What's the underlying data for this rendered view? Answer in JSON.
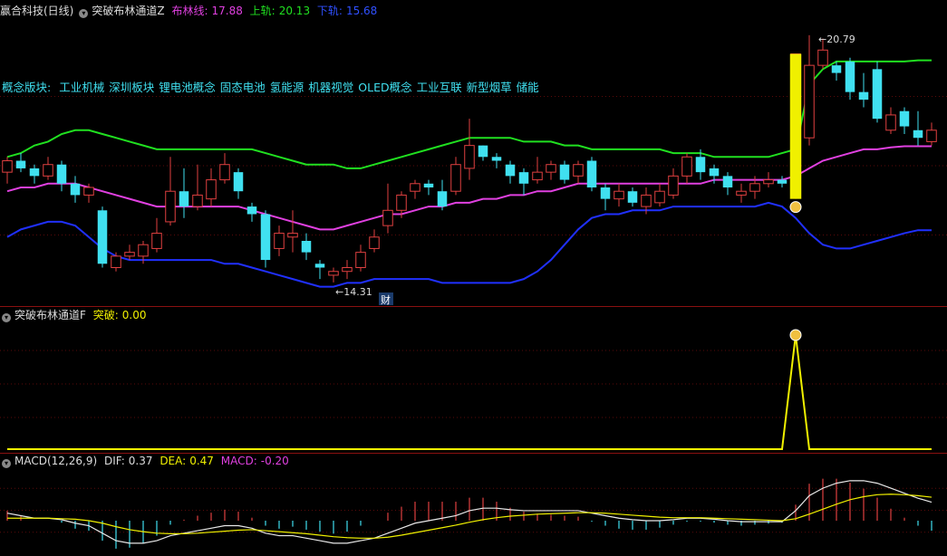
{
  "main_panel": {
    "stock_name": "赢合科技(日线)",
    "indicator": "突破布林通道Z",
    "mid_label": "布林线:",
    "mid_value": "17.88",
    "upper_label": "上轨:",
    "upper_value": "20.13",
    "lower_label": "下轨:",
    "lower_value": "15.68",
    "high_marker": "20.79",
    "low_marker": "14.31",
    "fin_marker": "财",
    "concept_label": "概念版块:",
    "concepts": [
      "工业机械",
      "深圳板块",
      "锂电池概念",
      "固态电池",
      "氢能源",
      "机器视觉",
      "OLED概念",
      "工业互联",
      "新型烟草",
      "储能"
    ]
  },
  "signal_panel": {
    "indicator": "突破布林通道F",
    "signal_label": "突破:",
    "signal_value": "0.00"
  },
  "macd_panel": {
    "indicator": "MACD(12,26,9)",
    "dif_label": "DIF:",
    "dif_value": "0.37",
    "dea_label": "DEA:",
    "dea_value": "0.47",
    "macd_label": "MACD:",
    "macd_value": "-0.20"
  },
  "colors": {
    "up": "#e04040",
    "down": "#40e0f0",
    "boll_mid": "#e040e0",
    "boll_up": "#20e020",
    "boll_dn": "#2030ff",
    "signal": "#f0f000",
    "dif": "#e8e8e8",
    "dea": "#f0f000"
  },
  "chart_data": {
    "type": "candlestick",
    "candles": [
      [
        17.2,
        17.5,
        16.9,
        17.6
      ],
      [
        17.5,
        17.3,
        17.2,
        17.7
      ],
      [
        17.3,
        17.1,
        16.9,
        17.4
      ],
      [
        17.1,
        17.4,
        17.0,
        17.6
      ],
      [
        17.4,
        16.9,
        16.7,
        17.5
      ],
      [
        16.9,
        16.6,
        16.4,
        17.1
      ],
      [
        16.6,
        16.8,
        16.4,
        16.9
      ],
      [
        16.2,
        14.8,
        14.7,
        16.3
      ],
      [
        14.7,
        15.0,
        14.6,
        15.1
      ],
      [
        15.0,
        15.1,
        14.9,
        15.3
      ],
      [
        15.0,
        15.3,
        14.8,
        15.4
      ],
      [
        15.2,
        15.6,
        15.1,
        16.0
      ],
      [
        15.9,
        16.7,
        15.8,
        17.6
      ],
      [
        16.7,
        16.3,
        16.0,
        17.3
      ],
      [
        16.3,
        16.6,
        16.2,
        17.4
      ],
      [
        16.5,
        17.0,
        16.3,
        17.3
      ],
      [
        17.0,
        17.4,
        16.9,
        17.7
      ],
      [
        17.2,
        16.7,
        16.5,
        17.3
      ],
      [
        16.3,
        16.1,
        15.9,
        16.4
      ],
      [
        16.1,
        14.9,
        14.7,
        16.2
      ],
      [
        15.2,
        15.6,
        15.0,
        15.8
      ],
      [
        15.5,
        15.6,
        15.1,
        16.2
      ],
      [
        15.4,
        15.1,
        14.9,
        15.6
      ],
      [
        14.8,
        14.7,
        14.4,
        14.9
      ],
      [
        14.5,
        14.6,
        14.31,
        14.7
      ],
      [
        14.6,
        14.7,
        14.4,
        14.9
      ],
      [
        14.7,
        15.1,
        14.6,
        15.3
      ],
      [
        15.2,
        15.5,
        15.1,
        15.7
      ],
      [
        15.8,
        16.2,
        15.6,
        16.9
      ],
      [
        16.2,
        16.6,
        16.0,
        16.7
      ],
      [
        16.7,
        16.9,
        16.5,
        17.0
      ],
      [
        16.9,
        16.8,
        16.6,
        17.0
      ],
      [
        16.7,
        16.3,
        16.2,
        17.0
      ],
      [
        16.7,
        17.4,
        16.6,
        17.6
      ],
      [
        17.3,
        17.9,
        17.0,
        18.6
      ],
      [
        17.9,
        17.6,
        17.5,
        17.9
      ],
      [
        17.6,
        17.5,
        17.3,
        17.7
      ],
      [
        17.4,
        17.1,
        16.9,
        17.5
      ],
      [
        17.2,
        16.9,
        16.6,
        17.3
      ],
      [
        17.0,
        17.2,
        16.9,
        17.6
      ],
      [
        17.2,
        17.4,
        17.0,
        17.5
      ],
      [
        17.4,
        17.0,
        16.9,
        17.5
      ],
      [
        17.1,
        17.4,
        16.9,
        17.5
      ],
      [
        17.5,
        16.8,
        16.7,
        17.6
      ],
      [
        16.8,
        16.5,
        16.2,
        16.9
      ],
      [
        16.5,
        16.7,
        16.3,
        16.9
      ],
      [
        16.7,
        16.4,
        16.3,
        16.8
      ],
      [
        16.3,
        16.6,
        16.1,
        16.8
      ],
      [
        16.4,
        16.7,
        16.3,
        16.9
      ],
      [
        16.6,
        17.1,
        16.5,
        17.3
      ],
      [
        17.1,
        17.6,
        16.9,
        17.7
      ],
      [
        17.6,
        17.2,
        17.0,
        17.8
      ],
      [
        17.3,
        17.1,
        16.9,
        17.4
      ],
      [
        17.1,
        16.8,
        16.6,
        17.2
      ],
      [
        16.6,
        16.7,
        16.4,
        16.9
      ],
      [
        16.7,
        16.9,
        16.5,
        17.1
      ],
      [
        16.9,
        17.0,
        16.8,
        17.2
      ],
      [
        17.0,
        16.9,
        16.8,
        17.1
      ],
      [
        16.8,
        20.3,
        16.5,
        20.3
      ],
      [
        18.1,
        20.0,
        17.9,
        20.79
      ],
      [
        20.0,
        20.4,
        19.9,
        20.7
      ],
      [
        20.0,
        19.8,
        19.6,
        20.1
      ],
      [
        20.1,
        19.3,
        19.1,
        20.2
      ],
      [
        19.3,
        19.1,
        18.9,
        19.8
      ],
      [
        19.9,
        18.6,
        18.5,
        20.1
      ],
      [
        18.3,
        18.7,
        18.2,
        18.9
      ],
      [
        18.8,
        18.4,
        18.2,
        18.9
      ],
      [
        18.3,
        18.1,
        17.9,
        18.8
      ],
      [
        18.0,
        18.3,
        17.9,
        18.5
      ]
    ],
    "boll_upper": [
      17.6,
      17.7,
      17.9,
      18.0,
      18.2,
      18.3,
      18.3,
      18.2,
      18.1,
      18.0,
      17.9,
      17.8,
      17.8,
      17.8,
      17.8,
      17.8,
      17.8,
      17.8,
      17.8,
      17.7,
      17.6,
      17.5,
      17.4,
      17.4,
      17.4,
      17.3,
      17.3,
      17.4,
      17.5,
      17.6,
      17.7,
      17.8,
      17.9,
      18.0,
      18.1,
      18.1,
      18.1,
      18.1,
      18.0,
      18.0,
      18.0,
      17.9,
      17.9,
      17.8,
      17.8,
      17.8,
      17.8,
      17.8,
      17.8,
      17.7,
      17.7,
      17.7,
      17.6,
      17.6,
      17.6,
      17.6,
      17.6,
      17.7,
      17.8,
      19.5,
      19.9,
      20.1,
      20.1,
      20.1,
      20.1,
      20.1,
      20.1,
      20.13,
      20.13
    ],
    "boll_mid": [
      16.7,
      16.8,
      16.8,
      16.9,
      16.9,
      16.9,
      16.8,
      16.7,
      16.6,
      16.5,
      16.4,
      16.3,
      16.3,
      16.3,
      16.3,
      16.3,
      16.3,
      16.3,
      16.2,
      16.1,
      16.0,
      15.9,
      15.8,
      15.7,
      15.7,
      15.8,
      15.9,
      16.0,
      16.1,
      16.1,
      16.2,
      16.3,
      16.3,
      16.4,
      16.4,
      16.5,
      16.5,
      16.6,
      16.6,
      16.7,
      16.7,
      16.8,
      16.9,
      16.9,
      16.9,
      16.9,
      16.9,
      16.9,
      16.9,
      16.9,
      16.9,
      16.9,
      17.0,
      17.0,
      17.0,
      17.0,
      17.0,
      17.0,
      17.1,
      17.3,
      17.5,
      17.6,
      17.7,
      17.8,
      17.8,
      17.85,
      17.88,
      17.88,
      17.88
    ],
    "boll_lower": [
      15.5,
      15.7,
      15.8,
      15.9,
      15.9,
      15.8,
      15.5,
      15.2,
      15.0,
      14.9,
      14.9,
      14.9,
      14.9,
      14.9,
      14.9,
      14.9,
      14.8,
      14.8,
      14.7,
      14.6,
      14.5,
      14.4,
      14.3,
      14.2,
      14.2,
      14.3,
      14.3,
      14.4,
      14.4,
      14.4,
      14.4,
      14.4,
      14.3,
      14.3,
      14.3,
      14.3,
      14.3,
      14.3,
      14.4,
      14.6,
      14.9,
      15.3,
      15.7,
      16.0,
      16.1,
      16.1,
      16.2,
      16.2,
      16.2,
      16.3,
      16.3,
      16.3,
      16.3,
      16.3,
      16.3,
      16.3,
      16.4,
      16.3,
      16.0,
      15.6,
      15.3,
      15.2,
      15.2,
      15.3,
      15.4,
      15.5,
      15.6,
      15.68,
      15.68
    ],
    "signal": [
      0,
      0,
      0,
      0,
      0,
      0,
      0,
      0,
      0,
      0,
      0,
      0,
      0,
      0,
      0,
      0,
      0,
      0,
      0,
      0,
      0,
      0,
      0,
      0,
      0,
      0,
      0,
      0,
      0,
      0,
      0,
      0,
      0,
      0,
      0,
      0,
      0,
      0,
      0,
      0,
      0,
      0,
      0,
      0,
      0,
      0,
      0,
      0,
      0,
      0,
      0,
      0,
      0,
      0,
      0,
      0,
      0,
      0,
      1,
      0,
      0,
      0,
      0,
      0,
      0,
      0,
      0,
      0,
      0
    ],
    "dif": [
      0.15,
      0.1,
      0.05,
      0.05,
      0.02,
      -0.05,
      -0.1,
      -0.25,
      -0.4,
      -0.45,
      -0.45,
      -0.4,
      -0.3,
      -0.25,
      -0.2,
      -0.15,
      -0.1,
      -0.1,
      -0.15,
      -0.25,
      -0.3,
      -0.3,
      -0.35,
      -0.4,
      -0.45,
      -0.45,
      -0.4,
      -0.35,
      -0.25,
      -0.15,
      -0.05,
      0.0,
      0.05,
      0.1,
      0.2,
      0.25,
      0.25,
      0.22,
      0.2,
      0.2,
      0.2,
      0.2,
      0.2,
      0.15,
      0.1,
      0.05,
      0.02,
      0.0,
      0.0,
      0.02,
      0.05,
      0.05,
      0.03,
      0.0,
      -0.02,
      -0.02,
      -0.02,
      -0.02,
      0.2,
      0.5,
      0.65,
      0.75,
      0.8,
      0.8,
      0.75,
      0.65,
      0.55,
      0.45,
      0.37
    ],
    "dea": [
      0.05,
      0.05,
      0.05,
      0.05,
      0.04,
      0.03,
      0.0,
      -0.05,
      -0.12,
      -0.18,
      -0.22,
      -0.25,
      -0.26,
      -0.26,
      -0.25,
      -0.23,
      -0.21,
      -0.19,
      -0.18,
      -0.2,
      -0.22,
      -0.24,
      -0.26,
      -0.29,
      -0.32,
      -0.34,
      -0.35,
      -0.35,
      -0.33,
      -0.29,
      -0.24,
      -0.19,
      -0.14,
      -0.09,
      -0.03,
      0.02,
      0.06,
      0.09,
      0.11,
      0.13,
      0.14,
      0.15,
      0.16,
      0.16,
      0.15,
      0.13,
      0.11,
      0.09,
      0.07,
      0.06,
      0.06,
      0.06,
      0.05,
      0.04,
      0.03,
      0.02,
      0.01,
      0.0,
      0.04,
      0.13,
      0.23,
      0.33,
      0.42,
      0.48,
      0.52,
      0.53,
      0.52,
      0.5,
      0.47
    ],
    "y_range_price": [
      14.0,
      21.0
    ]
  }
}
